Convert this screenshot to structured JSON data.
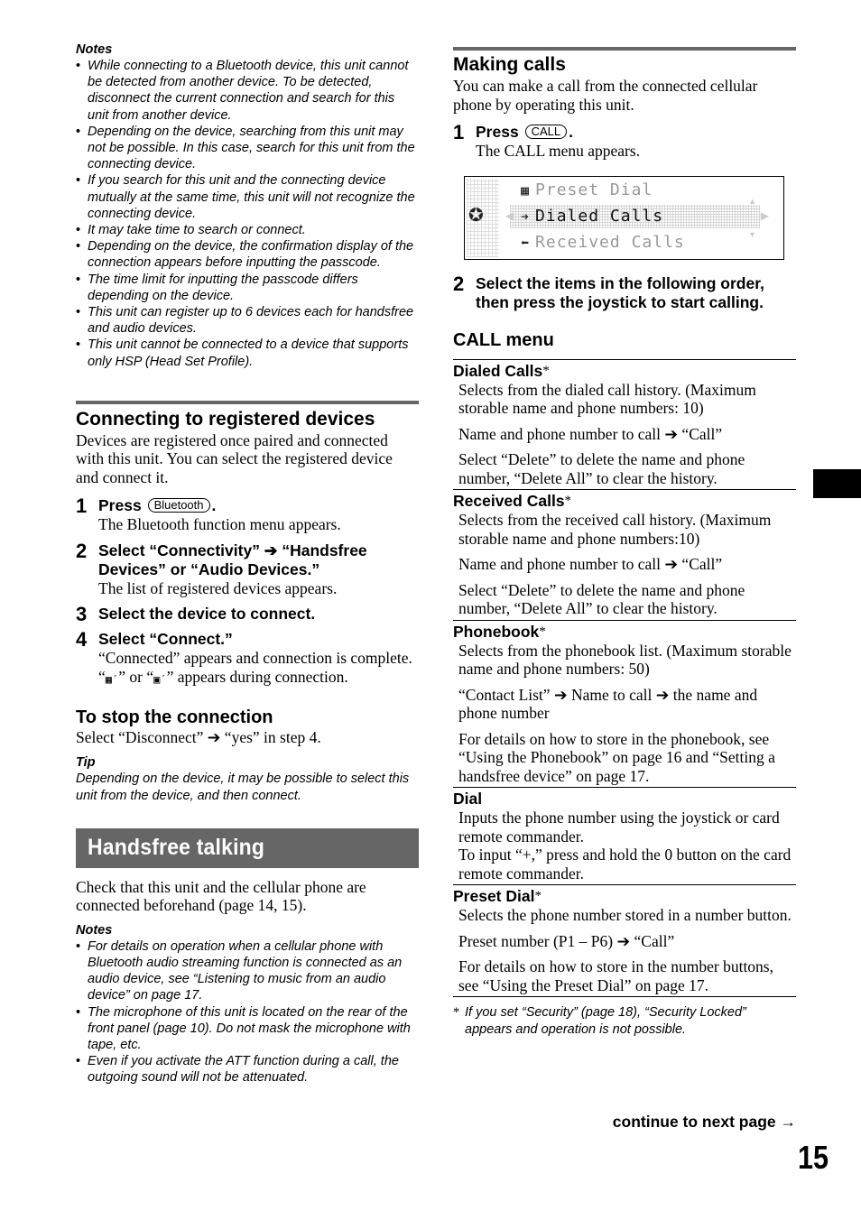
{
  "left": {
    "notes_top": {
      "title": "Notes",
      "items": [
        "While connecting to a Bluetooth device, this unit cannot be detected from another device. To be detected, disconnect the current connection and search for this unit from another device.",
        "Depending on the device, searching from this unit may not be possible. In this case, search for this unit from the connecting device.",
        "If you search for this unit and the connecting device mutually at the same time, this unit will not recognize the connecting device.",
        "It may take time to search or connect.",
        "Depending on the device, the confirmation display of the connection appears before inputting the passcode.",
        "The time limit for inputting the passcode differs depending on the device.",
        "This unit can register up to 6 devices each for handsfree and audio devices.",
        "This unit cannot be connected to a device that supports only HSP (Head Set Profile)."
      ]
    },
    "registered": {
      "heading": "Connecting to registered devices",
      "intro": "Devices are registered once paired and connected with this unit. You can select the registered device and connect it.",
      "steps": [
        {
          "num": "1",
          "title_prefix": "Press",
          "key": "Bluetooth",
          "title_suffix": ".",
          "desc": "The Bluetooth function menu appears."
        },
        {
          "num": "2",
          "title": "Select “Connectivity” ➔ “Handsfree Devices” or “Audio Devices.”",
          "desc": "The list of registered devices appears."
        },
        {
          "num": "3",
          "title": "Select the device to connect."
        },
        {
          "num": "4",
          "title": "Select “Connect.”",
          "desc": "“Connected” appears and connection is complete.",
          "desc2_a": "“",
          "icon_a": "handsfree-connecting-icon",
          "desc2_b": "” or “",
          "icon_b": "audio-connecting-icon",
          "desc2_c": "” appears during connection."
        }
      ]
    },
    "stop": {
      "heading": "To stop the connection",
      "text": "Select “Disconnect” ➔ “yes” in step 4."
    },
    "tip": {
      "title": "Tip",
      "text": "Depending on the device, it may be possible to select this unit from the device, and then connect."
    },
    "handsfree": {
      "banner": "Handsfree talking",
      "intro": "Check that this unit and the cellular phone are connected beforehand (page 14, 15).",
      "notes_title": "Notes",
      "notes": [
        "For details on operation when a cellular phone with Bluetooth audio streaming function is connected as an audio device, see “Listening to music from an audio device” on page 17.",
        "The microphone of this unit is located on the rear of the front panel (page 10). Do not mask the microphone with tape, etc.",
        "Even if you activate the ATT function during a call, the outgoing sound will not be attenuated."
      ]
    }
  },
  "right": {
    "making_calls": {
      "heading": "Making calls",
      "intro": "You can make a call from the connected cellular phone by operating this unit.",
      "step1": {
        "num": "1",
        "title_prefix": "Press",
        "key": "CALL",
        "title_suffix": ".",
        "desc": "The CALL menu appears."
      },
      "lcd": {
        "rows": [
          {
            "icon": "preset-dial-icon",
            "glyph": "▦",
            "label": "Preset Dial"
          },
          {
            "icon": "dialed-calls-icon",
            "glyph": "➔",
            "label": "Dialed Calls",
            "selected": true
          },
          {
            "icon": "received-calls-icon",
            "glyph": "⬅",
            "label": "Received Calls"
          }
        ]
      },
      "step2": {
        "num": "2",
        "title": "Select the items in the following order, then press the joystick to start calling."
      }
    },
    "call_menu": {
      "heading": "CALL menu",
      "items": [
        {
          "title": "Dialed Calls",
          "asterisk": "*",
          "paras": [
            "Selects from the dialed call history. (Maximum storable name and phone numbers: 10)",
            "Name and phone number to call ➔ “Call”",
            "Select “Delete” to delete the name and phone number, “Delete All” to clear the history."
          ]
        },
        {
          "title": "Received Calls",
          "asterisk": "*",
          "paras": [
            "Selects from the received call history. (Maximum storable name and phone numbers:10)",
            "Name and phone number to call ➔ “Call”",
            "Select “Delete” to delete the name and phone number, “Delete All” to clear the history."
          ]
        },
        {
          "title": "Phonebook",
          "asterisk": "*",
          "paras": [
            "Selects from the phonebook list. (Maximum storable name and phone numbers: 50)",
            "“Contact List” ➔ Name to call ➔ the name and phone number",
            "For details on how to store in the phonebook, see “Using the Phonebook” on page 16 and “Setting a handsfree device” on page 17."
          ]
        },
        {
          "title": "Dial",
          "asterisk": "",
          "paras": [
            "Inputs the phone number using the joystick or card remote commander.\nTo input “+,” press and hold the 0 button on the card remote commander."
          ]
        },
        {
          "title": "Preset Dial",
          "asterisk": "*",
          "paras": [
            "Selects the phone number stored in a number button.",
            "Preset number (P1 – P6) ➔ “Call”",
            "For details on how to store in the number buttons, see “Using the Preset Dial” on page 17."
          ]
        }
      ],
      "footnote_star": "*",
      "footnote": "If you set “Security” (page 18), “Security Locked” appears and operation is not possible."
    }
  },
  "footer": {
    "continue": "continue to next page →",
    "page_number": "15"
  }
}
